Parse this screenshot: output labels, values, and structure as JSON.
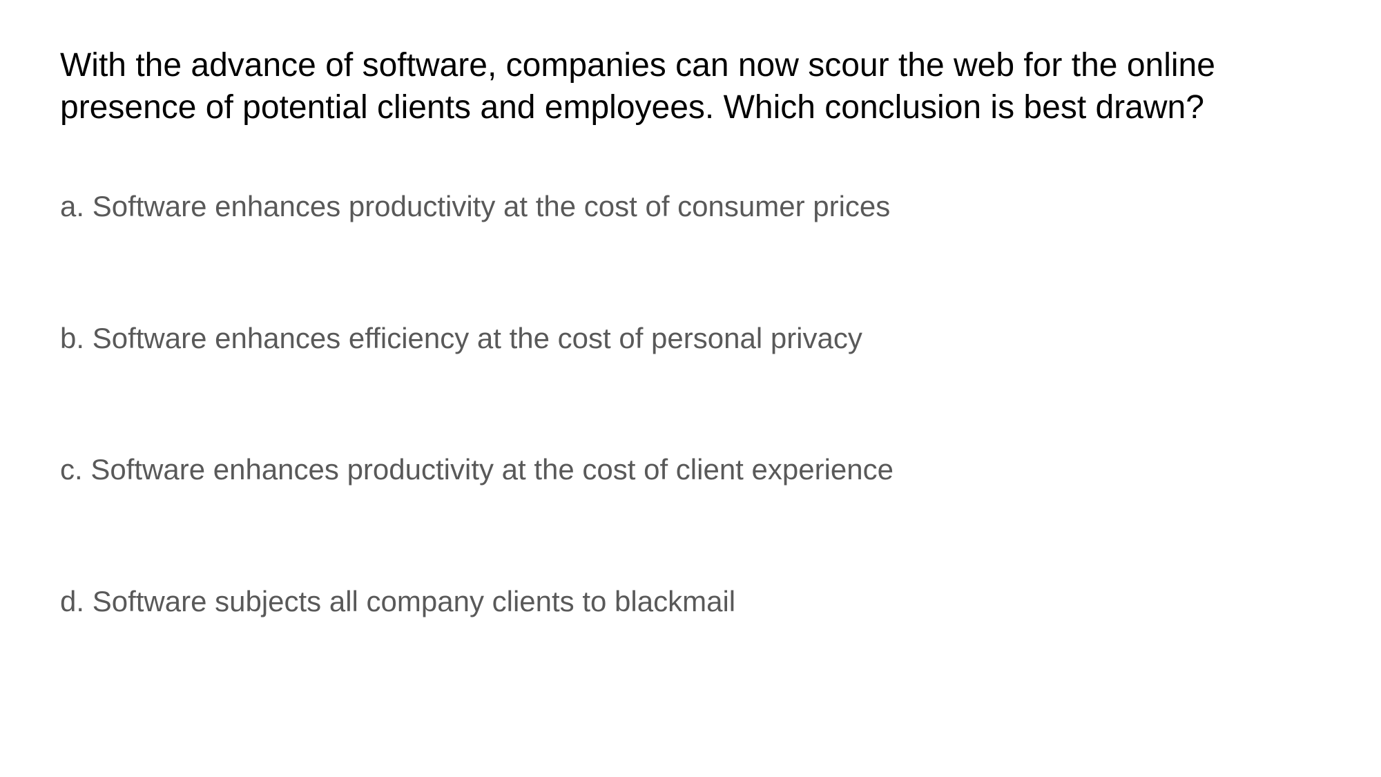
{
  "slide": {
    "question_line1": "With the advance of software, companies can now scour the web for the online",
    "question_line2": "presence of potential clients and employees. Which conclusion is best drawn?",
    "options": [
      {
        "text": "a. Software enhances productivity at the cost of consumer prices"
      },
      {
        "text": "b. Software enhances efficiency at the cost of personal privacy"
      },
      {
        "text": "c. Software enhances productivity at the cost of client experience"
      },
      {
        "text": "d. Software subjects all company clients to blackmail"
      }
    ]
  },
  "colors": {
    "background": "#ffffff",
    "question_text": "#000000",
    "option_text": "#595959"
  }
}
